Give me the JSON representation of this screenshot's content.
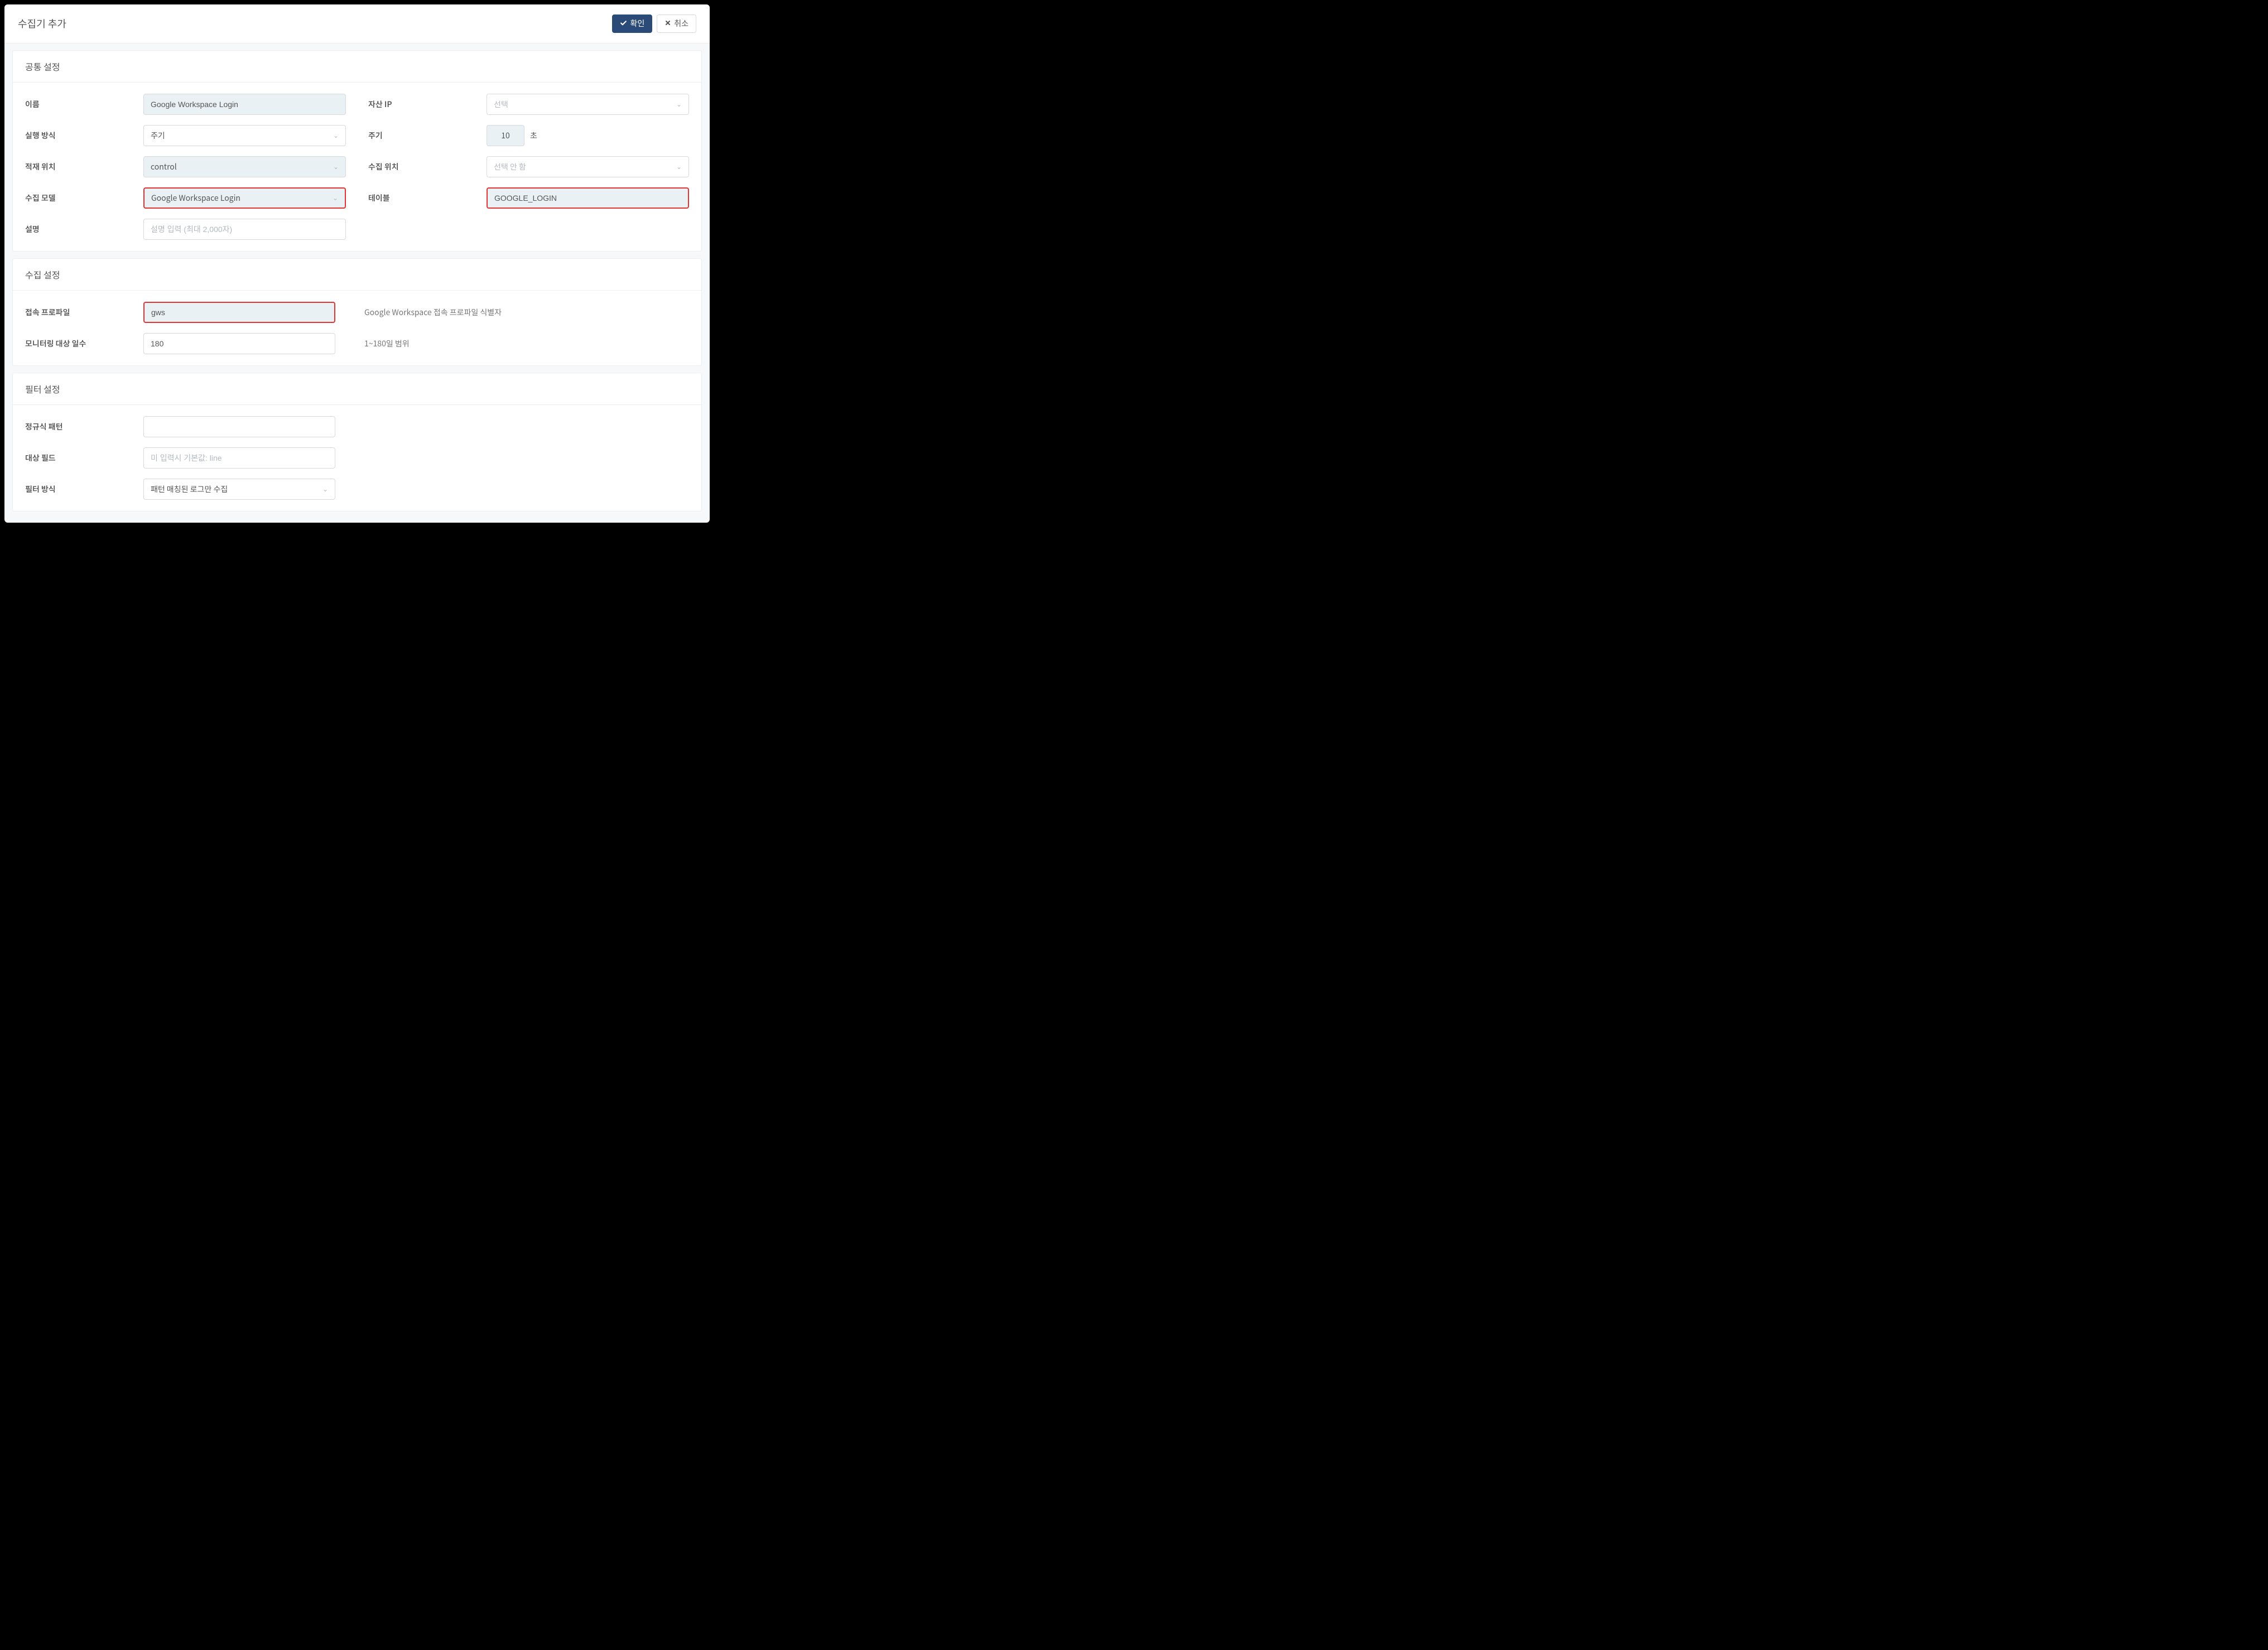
{
  "dialog": {
    "title": "수집기 추가",
    "confirm_label": "확인",
    "cancel_label": "취소"
  },
  "sections": {
    "common": {
      "title": "공통 설정",
      "fields": {
        "name_label": "이름",
        "name_value": "Google Workspace Login",
        "asset_ip_label": "자산 IP",
        "asset_ip_placeholder": "선택",
        "run_mode_label": "실행 방식",
        "run_mode_value": "주기",
        "period_label": "주기",
        "period_value": "10",
        "period_unit": "초",
        "load_loc_label": "적재 위치",
        "load_loc_value": "control",
        "collect_loc_label": "수집 위치",
        "collect_loc_placeholder": "선택 안 함",
        "model_label": "수집 모델",
        "model_value": "Google Workspace Login",
        "table_label": "테이블",
        "table_value": "GOOGLE_LOGIN",
        "desc_label": "설명",
        "desc_placeholder": "설명 입력 (최대 2,000자)"
      }
    },
    "collect": {
      "title": "수집 설정",
      "fields": {
        "profile_label": "접속 프로파일",
        "profile_value": "gws",
        "profile_helper": "Google Workspace 접속 프로파일 식별자",
        "days_label": "모니터링 대상 일수",
        "days_value": "180",
        "days_helper": "1~180일 범위"
      }
    },
    "filter": {
      "title": "필터 설정",
      "fields": {
        "regex_label": "정규식 패턴",
        "regex_value": "",
        "target_label": "대상 필드",
        "target_placeholder": "미 입력시 기본값: line",
        "mode_label": "필터 방식",
        "mode_value": "패턴 매칭된 로그만 수집"
      }
    }
  }
}
